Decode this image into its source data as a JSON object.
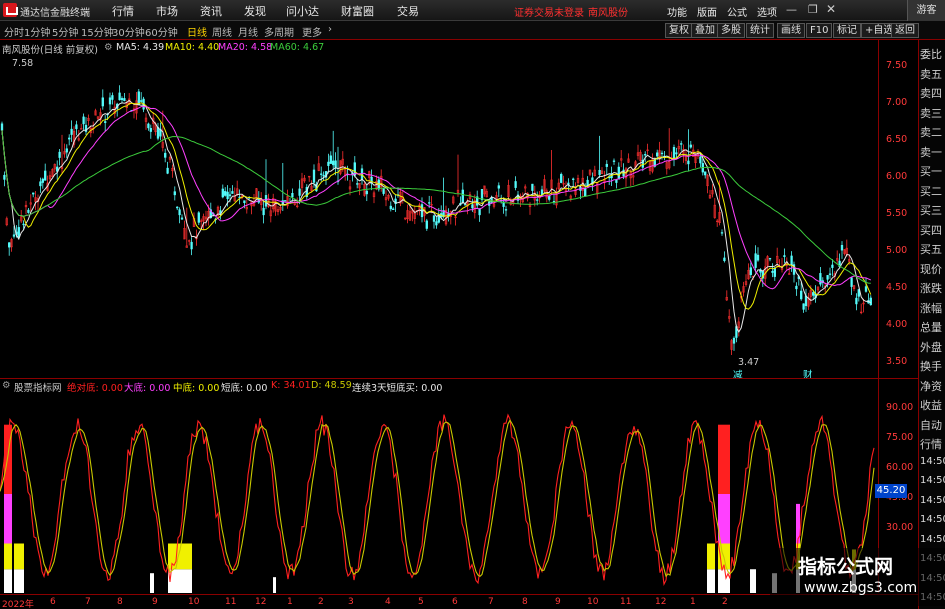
{
  "app": {
    "title": "通达信金融终端",
    "menu": [
      "行情",
      "市场",
      "资讯",
      "发现",
      "问小达",
      "财富圈",
      "交易"
    ],
    "notice": "证券交易未登录",
    "stock_name": "南风股份",
    "right_menu": [
      "功能",
      "版面",
      "公式",
      "选项"
    ],
    "guest": "游客"
  },
  "toolbar": {
    "periods": [
      "分时",
      "1分钟",
      "5分钟",
      "15分钟",
      "30分钟",
      "60分钟",
      "日线",
      "周线",
      "月线",
      "多周期",
      "更多"
    ],
    "active": "日线",
    "right_tools": [
      "复权",
      "叠加",
      "多股",
      "统计",
      "画线",
      "F10",
      "标记",
      "+自选",
      "返回"
    ]
  },
  "main_header": {
    "stock": "南风股份(日线 前复权)",
    "ma5": "MA5: 4.39",
    "ma10": "MA10: 4.40",
    "ma20": "MA20: 4.58",
    "ma60": "MA60: 4.67"
  },
  "colors": {
    "up": "#ff3030",
    "down": "#54fcfc",
    "ma5": "#e8e8e8",
    "ma10": "#f0f000",
    "ma20": "#ff40ff",
    "ma60": "#3ccc3c",
    "k": "#ff2020",
    "d": "#c8c800"
  },
  "price_axis": [
    "7.50",
    "7.00",
    "6.50",
    "6.00",
    "5.50",
    "5.00",
    "4.50",
    "4.00",
    "3.50"
  ],
  "price_marks": {
    "high": "7.58",
    "low": "3.47",
    "tag1": "减",
    "tag2": "财"
  },
  "side_panel": [
    "委比",
    "卖五",
    "卖四",
    "卖三",
    "卖二",
    "卖一",
    "买一",
    "买二",
    "买三",
    "买四",
    "买五",
    "现价",
    "涨跌",
    "涨幅",
    "总量",
    "外盘",
    "换手",
    "净资",
    "收益",
    "自动",
    "行情",
    "14:50",
    "14:50",
    "14:50",
    "14:50",
    "14:50",
    "14:50",
    "14:50",
    "14:50"
  ],
  "sub_header": {
    "name": "股票指标网",
    "l1": "绝对底: 0.00",
    "l2": "大底: 0.00",
    "l3": "中底: 0.00",
    "l4": "短底: 0.00",
    "k": "K: 34.01",
    "d": "D: 48.59",
    "l5": "连续3天短底买: 0.00"
  },
  "sub_axis": [
    "90.00",
    "75.00",
    "60.00",
    "45.00",
    "30.00"
  ],
  "sub_badge": "45.20",
  "dates": [
    "2022年",
    "6",
    "7",
    "8",
    "9",
    "10",
    "11",
    "12",
    "1",
    "2",
    "3",
    "4",
    "5",
    "6",
    "7",
    "8",
    "9",
    "10",
    "11",
    "12",
    "1",
    "2"
  ],
  "watermark": {
    "title": "指标公式网",
    "url": "www.zbgs3.com"
  }
}
